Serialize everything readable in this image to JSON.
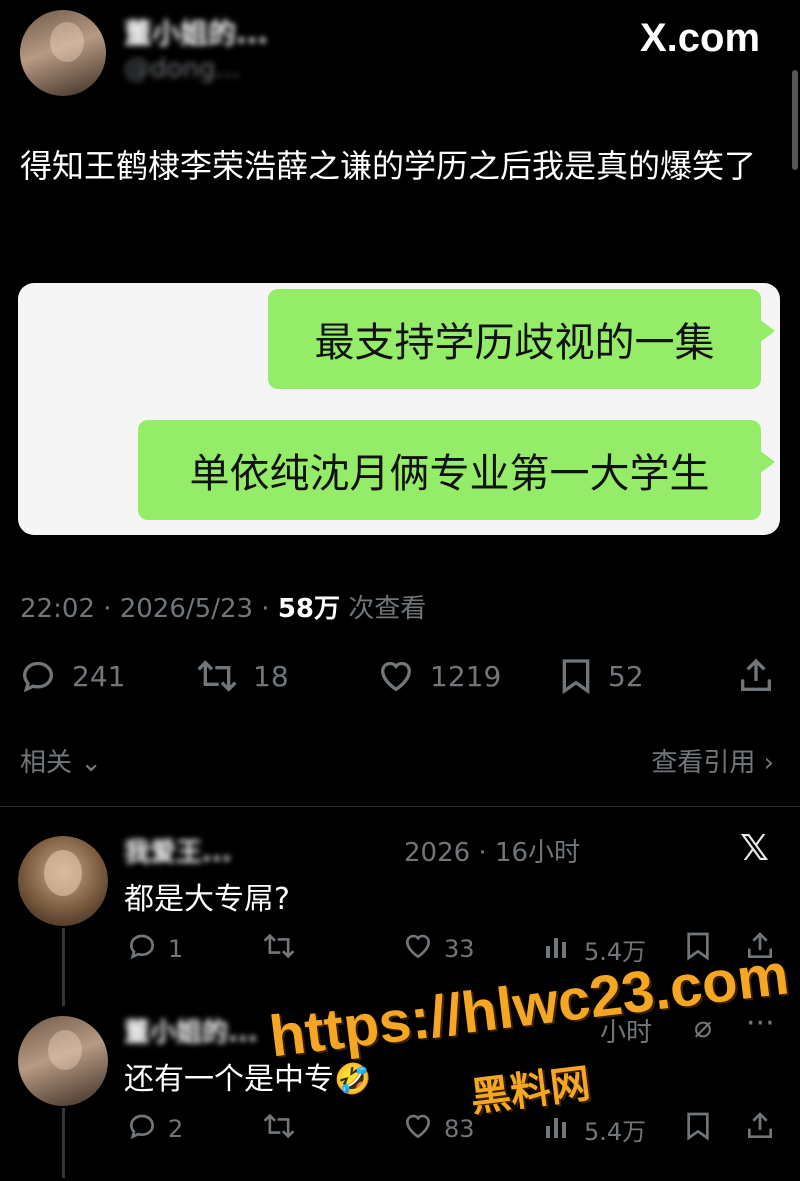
{
  "header": {
    "display_name": "董小姐的...",
    "handle": "@dong...",
    "site_logo": "X.com"
  },
  "tweet": {
    "text": "得知王鹤棣李荣浩薛之谦的学历之后我是真的爆笑了",
    "chat_messages": [
      "最支持学历歧视的一集",
      "单依纯沈月俩专业第一大学生"
    ],
    "timestamp": "22:02 · 2026/5/23 · ",
    "views_count": "58万",
    "views_label": " 次查看",
    "replies": "241",
    "retweets": "18",
    "likes": "1219",
    "bookmarks": "52"
  },
  "related": {
    "label": "相关",
    "quotes_label": "查看引用"
  },
  "reply_1": {
    "name": "我爱王...",
    "time": "2026 · 16小时",
    "text": "都是大专屌?",
    "replies": "1",
    "likes": "33",
    "views": "5.4万"
  },
  "reply_2": {
    "name": "董小姐的...",
    "time": "小时",
    "text": "还有一个是中专🤣",
    "replies": "2",
    "likes": "83",
    "views": "5.4万"
  },
  "watermark": {
    "url": "https://hlwc23.com",
    "label": "黑料网"
  },
  "icons": [
    "reply-icon",
    "retweet-icon",
    "like-icon",
    "bookmark-icon",
    "share-icon",
    "x-logo-icon",
    "chevron-down-icon",
    "chevron-right-icon",
    "views-icon",
    "more-icon"
  ]
}
